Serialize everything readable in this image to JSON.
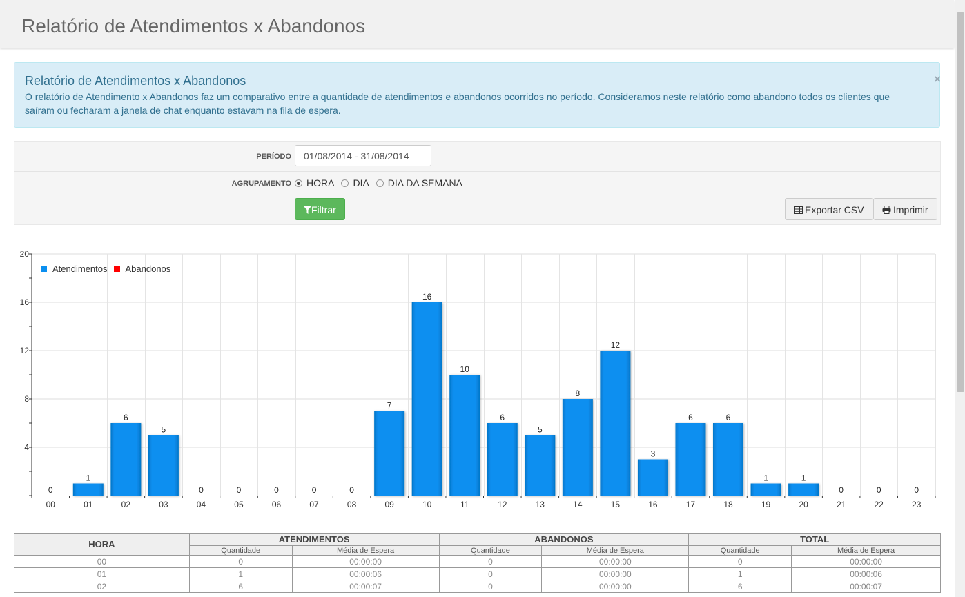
{
  "header": {
    "title": "Relatório de Atendimentos x Abandonos"
  },
  "alert": {
    "title": "Relatório de Atendimentos x Abandonos",
    "text": "O relatório de Atendimento x Abandonos faz um comparativo entre a quantidade de atendimentos e abandonos ocorridos no período. Consideramos neste relatório como abandono todos os clientes que saíram ou fecharam a janela de chat enquanto estavam na fila de espera.",
    "close": "×"
  },
  "filters": {
    "period_label": "PERÍODO",
    "period_value": "01/08/2014 - 31/08/2014",
    "group_label": "AGRUPAMENTO",
    "group_options": [
      "HORA",
      "DIA",
      "DIA DA SEMANA"
    ],
    "group_selected": "HORA",
    "filter_button": "Filtrar",
    "export_button": "Exportar CSV",
    "print_button": "Imprimir"
  },
  "colors": {
    "atendimentos": "#0a8ff0",
    "abandonos": "#ff0000",
    "filter_btn": "#5cb85c"
  },
  "chart_data": {
    "type": "bar",
    "categories": [
      "00",
      "01",
      "02",
      "03",
      "04",
      "05",
      "06",
      "07",
      "08",
      "09",
      "10",
      "11",
      "12",
      "13",
      "14",
      "15",
      "16",
      "17",
      "18",
      "19",
      "20",
      "21",
      "22",
      "23"
    ],
    "series": [
      {
        "name": "Atendimentos",
        "values": [
          0,
          1,
          6,
          5,
          0,
          0,
          0,
          0,
          0,
          7,
          16,
          10,
          6,
          5,
          8,
          12,
          3,
          6,
          6,
          1,
          1,
          0,
          0,
          0
        ]
      },
      {
        "name": "Abandonos",
        "values": [
          0,
          0,
          0,
          0,
          0,
          0,
          0,
          0,
          0,
          0,
          0,
          0,
          0,
          0,
          0,
          0,
          0,
          0,
          0,
          0,
          0,
          0,
          0,
          0
        ]
      }
    ],
    "yticks": [
      4,
      8,
      12,
      16,
      20
    ],
    "ylim": [
      0,
      20
    ],
    "grid": true,
    "legend": "top-left"
  },
  "table": {
    "headers": {
      "hora": "HORA",
      "atendimentos": "ATENDIMENTOS",
      "abandonos": "ABANDONOS",
      "total": "TOTAL"
    },
    "subheaders": {
      "quantidade": "Quantidade",
      "media": "Média de Espera"
    },
    "rows": [
      [
        "00",
        "0",
        "00:00:00",
        "0",
        "00:00:00",
        "0",
        "00:00:00"
      ],
      [
        "01",
        "1",
        "00:00:06",
        "0",
        "00:00:00",
        "1",
        "00:00:06"
      ],
      [
        "02",
        "6",
        "00:00:07",
        "0",
        "00:00:00",
        "6",
        "00:00:07"
      ]
    ]
  }
}
